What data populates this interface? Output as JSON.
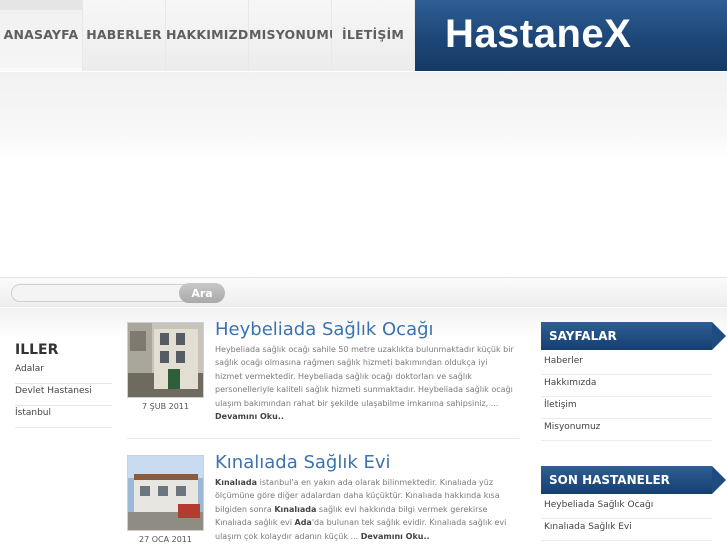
{
  "nav": {
    "items": [
      {
        "label": "ANASAYFA",
        "active": true
      },
      {
        "label": "HABERLER"
      },
      {
        "label": "HAKKIMIZDA"
      },
      {
        "label": "MISYONUMUZ"
      },
      {
        "label": "İLETİŞİM"
      }
    ]
  },
  "logo": {
    "text": "HastaneX"
  },
  "search": {
    "placeholder": "",
    "button_label": "Ara"
  },
  "left": {
    "title": "ILLER",
    "items": [
      "Adalar",
      "Devlet Hastanesi",
      "İstanbul"
    ]
  },
  "posts": [
    {
      "title": "Heybeliada Sağlık Ocağı",
      "date": "7 ŞUB 2011",
      "text": "Heybeliada sağlık ocağı  sahile 50 metre uzaklıkta bulunmaktadır küçük bir sağlık ocağı olmasına rağmen sağlık hizmeti bakımından oldukça iyi hizmet vermektedir. Heybeliada sağlık ocağı doktorları ve sağlık personelleriyle kaliteli sağlık hizmeti sunmaktadır. Heybeliada sağlık ocağı ulaşım bakımından rahat bir şekilde ulaşabilme imkanına sahipsiniz, ...",
      "more": "Devamını Oku.."
    },
    {
      "title": "Kınalıada Sağlık Evi",
      "date": "27 OCA 2011",
      "text_parts": [
        {
          "t": "Kınalıada",
          "b": true
        },
        {
          "t": " istanbul'a en yakın ada olarak bilinmektedir. Kınalıada yüz ölçümüne göre diğer adalardan daha küçüktür. Kınalıada hakkında kısa bilgiden sonra ",
          "b": false
        },
        {
          "t": "Kınalıada",
          "b": true
        },
        {
          "t": " sağlık evi hakkında bilgi vermek gerekirse Kınalıada sağlık evi  ",
          "b": false
        },
        {
          "t": "Ada",
          "b": true
        },
        {
          "t": "'da bulunan tek sağlık evidir. Kınalıada sağlık evi ulaşım çok kolaydır adanın küçük ...",
          "b": false
        }
      ],
      "more": "Devamını Oku.."
    }
  ],
  "sidebar": {
    "pages_title": "SAYFALAR",
    "pages": [
      "Haberler",
      "Hakkımızda",
      "İletişim",
      "Misyonumuz"
    ],
    "hospitals_title": "SON HASTANELER",
    "hospitals": [
      "Heybeliada Sağlık Ocağı",
      "Kınalıada Sağlık Evi"
    ]
  }
}
